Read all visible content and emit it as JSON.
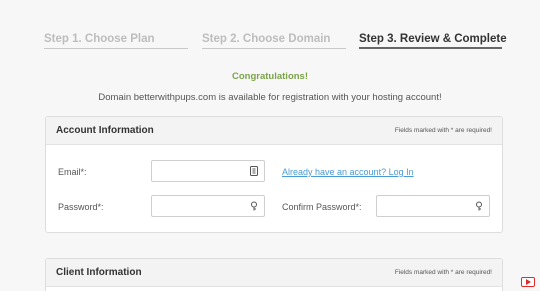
{
  "steps": [
    {
      "label": "Step 1. Choose Plan"
    },
    {
      "label": "Step 2. Choose Domain"
    },
    {
      "label": "Step 3. Review & Complete"
    }
  ],
  "congrats": "Congratulations!",
  "domain_message": "Domain betterwithpups.com is available for registration with your hosting account!",
  "account_panel": {
    "title": "Account Information",
    "required_note": "Fields marked with * are required!",
    "email_label": "Email*:",
    "email_value": "",
    "login_link": "Already have an account? Log In",
    "password_label": "Password*:",
    "password_value": "",
    "confirm_label": "Confirm Password*:",
    "confirm_value": ""
  },
  "client_panel": {
    "title": "Client Information",
    "required_note": "Fields marked with * are required!"
  },
  "icons": {
    "email_field_icon": "id-card-icon",
    "password_field_icon": "key-icon",
    "confirm_field_icon": "key-icon",
    "corner_badge": "youtube-icon"
  },
  "colors": {
    "active_step": "#333333",
    "inactive_step": "#bdbdbd",
    "congrats": "#7aa34a",
    "link": "#4a9bd1"
  }
}
